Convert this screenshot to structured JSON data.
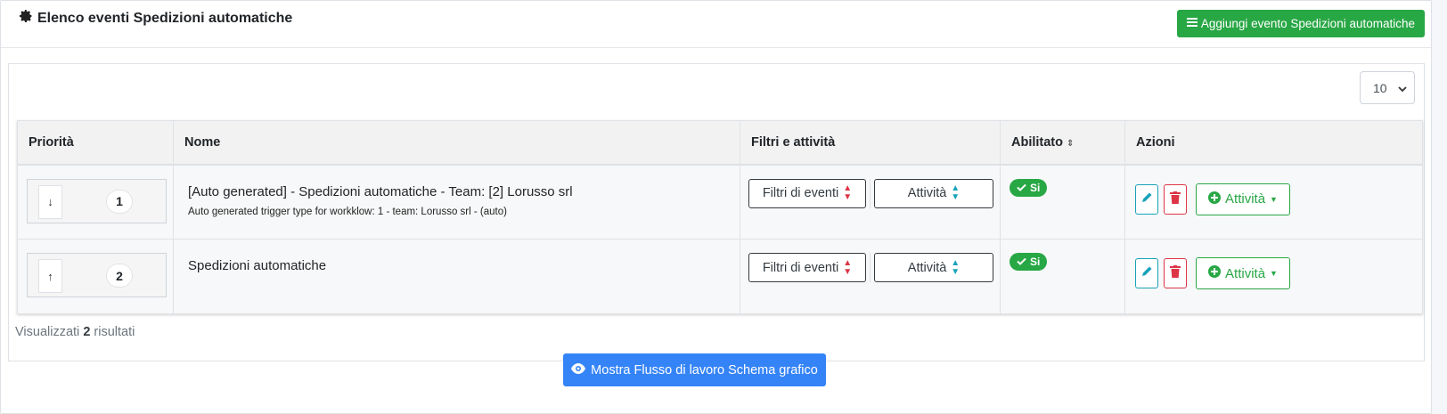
{
  "header": {
    "title": "Elenco eventi Spedizioni automatiche",
    "add_button": "Aggiungi evento Spedizioni automatiche"
  },
  "per_page": "10",
  "table": {
    "columns": [
      "Priorità",
      "Nome",
      "Filtri e attività",
      "Abilitato",
      "Azioni"
    ],
    "rows": [
      {
        "arrow": "↓",
        "priority": "1",
        "name": "[Auto generated] - Spedizioni automatiche - Team: [2] Lorusso srl",
        "description": "Auto generated trigger type for workklow: 1 - team: Lorusso srl - (auto)",
        "filter_label": "Filtri di eventi",
        "activity_label": "Attività",
        "enabled": "Si",
        "actions_label": "Attività"
      },
      {
        "arrow": "↑",
        "priority": "2",
        "name": "Spedizioni automatiche",
        "description": "",
        "filter_label": "Filtri di eventi",
        "activity_label": "Attività",
        "enabled": "Si",
        "actions_label": "Attività"
      }
    ]
  },
  "results": {
    "prefix": "Visualizzati",
    "count": "2",
    "suffix": "risultati"
  },
  "flow_button": "Mostra Flusso di lavoro Schema grafico",
  "colors": {
    "green": "#28a745",
    "blue": "#3584f7",
    "red": "#dc3545",
    "teal": "#17a2b8"
  }
}
